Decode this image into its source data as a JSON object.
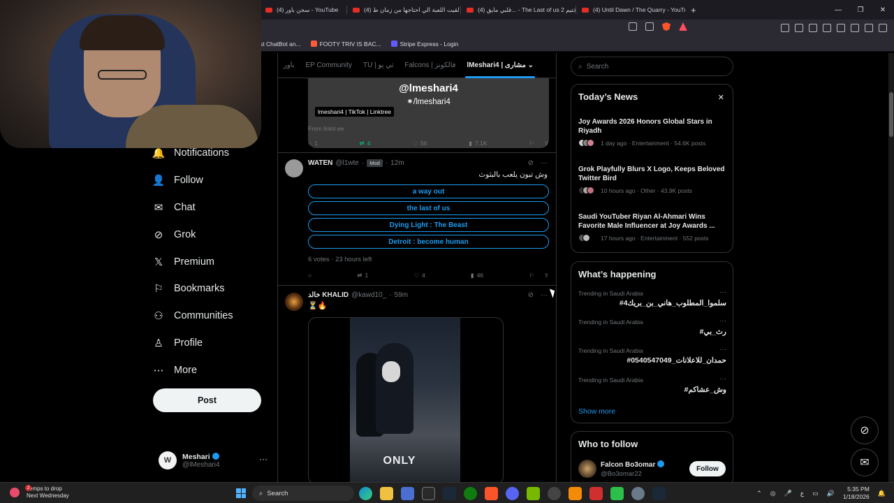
{
  "browser": {
    "tabs": [
      {
        "label": "(4) سجن باور - YouTube"
      },
      {
        "label": "(4) لقيت اللعبة الي احتاجها من زمان ط"
      },
      {
        "label": "(4) قلبي مايق... - The Last of us 2 تختيم"
      },
      {
        "label": "(4) Until Dawn / The Quarry - YouTub"
      }
    ],
    "new_tab": "+",
    "window_controls": [
      "—",
      "❐",
      "✕"
    ],
    "bookmarks": [
      {
        "label": "st ChatBot an...",
        "color": "#00a67e"
      },
      {
        "label": "FOOTY TRIV IS BAC...",
        "color": "#ff5b3a"
      },
      {
        "label": "Stripe Express - Login",
        "color": "#635bff"
      }
    ]
  },
  "sidebar": {
    "items": [
      {
        "label": "Notifications",
        "icon": "bell-icon",
        "glyph": "🔔"
      },
      {
        "label": "Follow",
        "icon": "follow-icon",
        "glyph": "👤"
      },
      {
        "label": "Chat",
        "icon": "chat-icon",
        "glyph": "✉"
      },
      {
        "label": "Grok",
        "icon": "grok-icon",
        "glyph": "⊘"
      },
      {
        "label": "Premium",
        "icon": "x-icon",
        "glyph": "𝕏"
      },
      {
        "label": "Bookmarks",
        "icon": "bookmark-icon",
        "glyph": "⚐"
      },
      {
        "label": "Communities",
        "icon": "communities-icon",
        "glyph": "⚇"
      },
      {
        "label": "Profile",
        "icon": "profile-icon",
        "glyph": "♙"
      },
      {
        "label": "More",
        "icon": "more-icon",
        "glyph": "⋯"
      }
    ],
    "post_label": "Post",
    "account": {
      "name": "Meshari",
      "handle": "@lMeshari4",
      "avatar_letter": "W",
      "more": "···"
    }
  },
  "main": {
    "tabs": [
      "باور",
      "EP Community",
      "TU | تي يو",
      "Falcons | فالكونز"
    ],
    "active_tab": "lMeshari4 | مشارى",
    "active_tab_chevron": "⌄",
    "card": {
      "handle": "@lmeshari4",
      "tiktok": "⁕/lmeshari4",
      "label": "lmeshari4 | TikTok | Linktree",
      "from": "From linktr.ee"
    },
    "card_actions": {
      "replies": "1",
      "reposts": "4",
      "likes": "56",
      "views": "7.1K"
    },
    "poll_tweet": {
      "name": "WATEN",
      "handle": "@l1wte",
      "badge": "Mod",
      "time": "12m",
      "text": "وش تبون يلعب بالبثوث",
      "options": [
        "a way out",
        "the last of us",
        "Dying Light : The Beast",
        "Detroit : become human"
      ],
      "votes": "6 votes · 23 hours left",
      "actions": {
        "replies": "",
        "reposts": "1",
        "likes": "4",
        "views": "46"
      }
    },
    "media_tweet": {
      "name": "خالد KHALID",
      "handle": "@kawd10_",
      "time": "59m",
      "text": "⏳🔥",
      "image_caption": "ONLY"
    },
    "sep": "·",
    "more_glyph": "···",
    "grok_glyph": "⊘"
  },
  "right": {
    "search_placeholder": "Search",
    "news": {
      "title": "Today’s News",
      "close": "✕",
      "items": [
        {
          "title": "Joy Awards 2026 Honors Global Stars in Riyadh",
          "meta": "1 day ago · Entertainment · 54.6K posts"
        },
        {
          "title": "Grok Playfully Blurs X Logo, Keeps Beloved Twitter Bird",
          "meta": "10 hours ago · Other · 43.9K posts"
        },
        {
          "title": "Saudi YouTuber Riyan Al-Ahmari Wins Favorite Male Influencer at Joy Awards ...",
          "meta": "17 hours ago · Entertainment · 552 posts"
        }
      ]
    },
    "happening": {
      "title": "What’s happening",
      "trends": [
        {
          "context": "Trending in Saudi Arabia",
          "tag": "#سلموا_المطلوب_هاني_بن_بريك4"
        },
        {
          "context": "Trending in Saudi Arabia",
          "tag": "#رث_بي"
        },
        {
          "context": "Trending in Saudi Arabia",
          "tag": "#حمدان_للاعلانات_0540547049"
        },
        {
          "context": "Trending in Saudi Arabia",
          "tag": "#وش_عشاكم"
        }
      ],
      "dots": "···",
      "show_more": "Show more"
    },
    "who_to_follow": {
      "title": "Who to follow",
      "name": "Falcon Bo3omar",
      "handle": "@Bo3omar22",
      "follow_label": "Follow"
    }
  },
  "taskbar": {
    "weather_line1": "Temps to drop",
    "weather_line2": "Next Wednesday",
    "weather_badge": "2",
    "search_label": "Search",
    "tray_lang": "ع",
    "time": "5:35 PM",
    "date": "1/18/2026",
    "tray_up": "⌃"
  },
  "colors": {
    "accent": "#1d9bf0",
    "repost_green": "#00ba7c",
    "background": "#000000"
  }
}
